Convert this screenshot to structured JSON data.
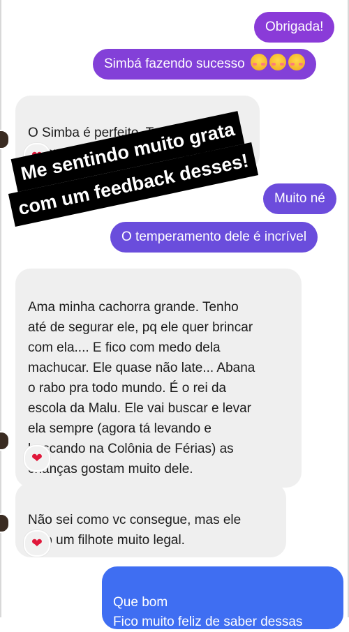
{
  "messages": [
    {
      "id": "m1",
      "text": "Obrigada!"
    },
    {
      "id": "m2",
      "text": "Simbá fazendo sucesso"
    },
    {
      "id": "m3",
      "text": "O Simba é perfeito. Traquinas,\ncompanheiro, carinhoso demais."
    },
    {
      "id": "m4",
      "text": "Muito né"
    },
    {
      "id": "m5",
      "text": "O temperamento dele é incrível"
    },
    {
      "id": "m6",
      "text": "Ama minha cachorra grande. Tenho\naté de segurar ele, pq ele quer brincar\ncom ela.... E fico com medo dela\nmachucar. Ele quase não late... Abana\no rabo pra todo mundo. É o rei da\nescola da Malu. Ele vai buscar e levar\nela sempre (agora tá levando e\nbuscando na Colônia de Férias) as\ncrianças gostam muito dele."
    },
    {
      "id": "m7",
      "text": "Não sei como vc consegue, mas ele\nveio um filhote muito legal."
    },
    {
      "id": "m8",
      "text": "Que bom\nFico muito feliz de saber dessas"
    }
  ],
  "overlay": {
    "line1": "Me sentindo muito grata",
    "line2": "com um feedback desses!"
  },
  "reaction": {
    "icon": "heart-icon",
    "glyph": "❤"
  },
  "emojis": [
    "smiling-face-with-hearts-icon",
    "smiling-face-with-hearts-icon",
    "smiling-face-with-hearts-icon"
  ],
  "colors": {
    "purple_top": "#8a3bd8",
    "purple_mid": "#6b4bdc",
    "blue_bottom": "#3f6ef2",
    "incoming": "#efefef",
    "heart": "#e0173a"
  }
}
